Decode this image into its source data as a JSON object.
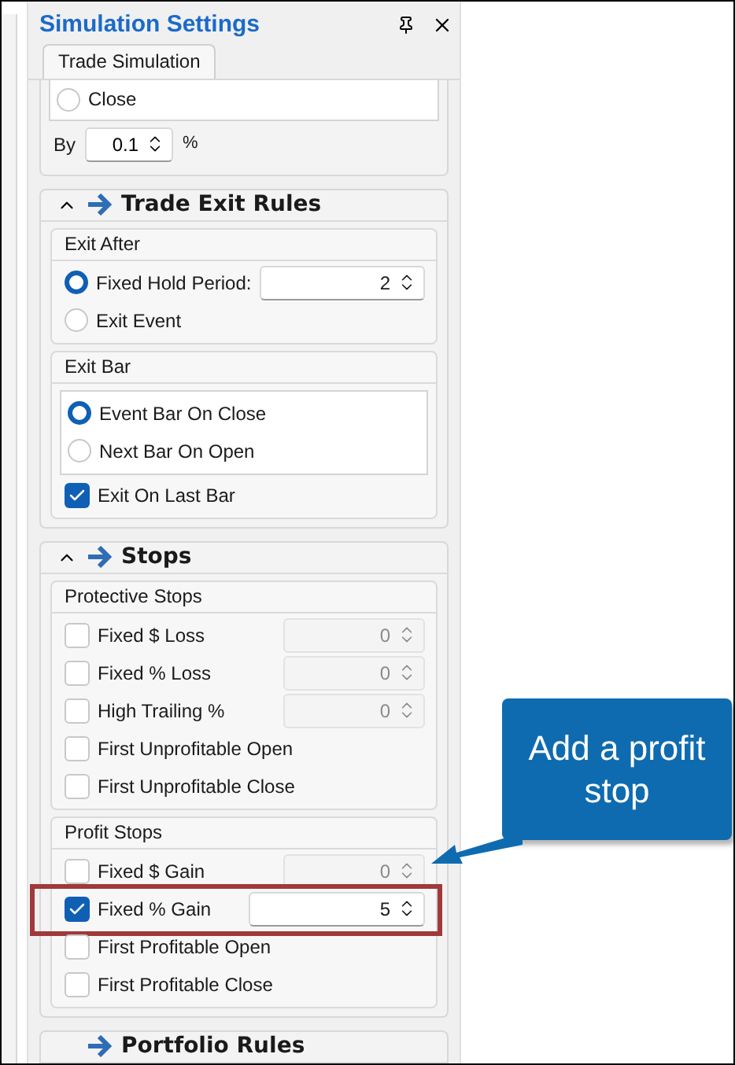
{
  "panel": {
    "title": "Simulation Settings",
    "tabs": [
      {
        "label": "Trade Simulation",
        "selected": true
      }
    ],
    "entry_partial": {
      "options": [
        {
          "label": "Close",
          "selected": false
        }
      ],
      "by_label": "By",
      "by_value": "0.1",
      "by_unit": "%"
    },
    "sections": [
      {
        "title": "Trade Exit Rules",
        "expanded": true,
        "groups": [
          {
            "title": "Exit After",
            "items": [
              {
                "kind": "radio",
                "label": "Fixed Hold Period:",
                "selected": true,
                "value": "2",
                "disabled": false
              },
              {
                "kind": "radio",
                "label": "Exit Event",
                "selected": false
              }
            ]
          },
          {
            "title": "Exit Bar",
            "inset": [
              {
                "label": "Event Bar On Close",
                "selected": true
              },
              {
                "label": "Next Bar On Open",
                "selected": false
              }
            ],
            "items": [
              {
                "kind": "checkbox",
                "label": "Exit On Last Bar",
                "checked": true
              }
            ]
          }
        ]
      },
      {
        "title": "Stops",
        "expanded": true,
        "groups": [
          {
            "title": "Protective Stops",
            "items": [
              {
                "kind": "checkbox",
                "label": "Fixed $ Loss",
                "checked": false,
                "value": "0",
                "disabled": true
              },
              {
                "kind": "checkbox",
                "label": "Fixed % Loss",
                "checked": false,
                "value": "0",
                "disabled": true
              },
              {
                "kind": "checkbox",
                "label": "High Trailing %",
                "checked": false,
                "value": "0",
                "disabled": true
              },
              {
                "kind": "checkbox",
                "label": "First Unprofitable Open",
                "checked": false
              },
              {
                "kind": "checkbox",
                "label": "First Unprofitable Close",
                "checked": false
              }
            ]
          },
          {
            "title": "Profit Stops",
            "items": [
              {
                "kind": "checkbox",
                "label": "Fixed $ Gain",
                "checked": false,
                "value": "0",
                "disabled": true
              },
              {
                "kind": "checkbox",
                "label": "Fixed % Gain",
                "checked": true,
                "value": "5",
                "disabled": false,
                "highlighted": true
              },
              {
                "kind": "checkbox",
                "label": "First Profitable Open",
                "checked": false
              },
              {
                "kind": "checkbox",
                "label": "First Profitable Close",
                "checked": false
              }
            ]
          }
        ]
      },
      {
        "title": "Portfolio Rules"
      }
    ]
  },
  "callout": {
    "text": "Add a profit stop"
  }
}
